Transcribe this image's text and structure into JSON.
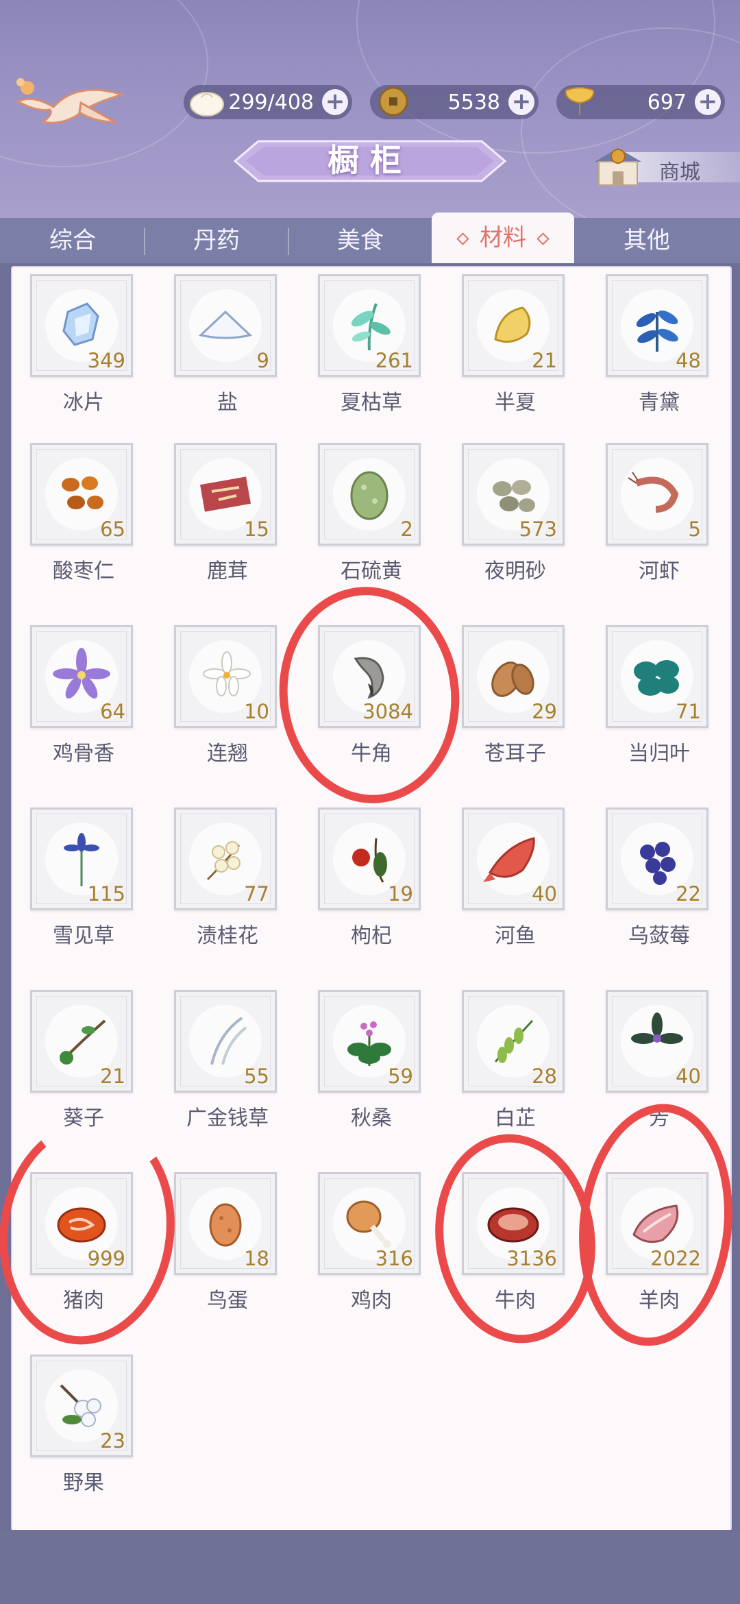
{
  "resources": [
    {
      "icon": "bun-icon",
      "value": "299/408"
    },
    {
      "icon": "coin-icon",
      "value": "5538"
    },
    {
      "icon": "ginkgo-leaf-icon",
      "value": "697"
    }
  ],
  "title": "橱柜",
  "shop_label": "商城",
  "tabs": [
    {
      "label": "综合"
    },
    {
      "label": "丹药"
    },
    {
      "label": "美食"
    },
    {
      "label": "材料",
      "active": true
    },
    {
      "label": "其他"
    }
  ],
  "items": [
    {
      "name": "冰片",
      "count": "349",
      "icon": "ice-crystal-icon"
    },
    {
      "name": "盐",
      "count": "9",
      "icon": "salt-pile-icon"
    },
    {
      "name": "夏枯草",
      "count": "261",
      "icon": "herb-icon"
    },
    {
      "name": "半夏",
      "count": "21",
      "icon": "tuber-icon"
    },
    {
      "name": "青黛",
      "count": "48",
      "icon": "blue-herb-icon"
    },
    {
      "name": "酸枣仁",
      "count": "65",
      "icon": "jujube-seed-icon"
    },
    {
      "name": "鹿茸",
      "count": "15",
      "icon": "antler-velvet-icon"
    },
    {
      "name": "石硫黄",
      "count": "2",
      "icon": "mineral-egg-icon"
    },
    {
      "name": "夜明砂",
      "count": "573",
      "icon": "pebbles-icon"
    },
    {
      "name": "河虾",
      "count": "5",
      "icon": "shrimp-icon"
    },
    {
      "name": "鸡骨香",
      "count": "64",
      "icon": "purple-flower-icon"
    },
    {
      "name": "连翘",
      "count": "10",
      "icon": "white-flower-icon"
    },
    {
      "name": "牛角",
      "count": "3084",
      "icon": "ox-horn-icon"
    },
    {
      "name": "苍耳子",
      "count": "29",
      "icon": "seed-pod-icon"
    },
    {
      "name": "当归叶",
      "count": "71",
      "icon": "green-leaf-icon"
    },
    {
      "name": "雪见草",
      "count": "115",
      "icon": "blue-flower-icon"
    },
    {
      "name": "渍桂花",
      "count": "77",
      "icon": "osmanthus-icon"
    },
    {
      "name": "枸杞",
      "count": "19",
      "icon": "goji-berry-icon"
    },
    {
      "name": "河鱼",
      "count": "40",
      "icon": "fish-icon"
    },
    {
      "name": "乌蔹莓",
      "count": "22",
      "icon": "berries-icon"
    },
    {
      "name": "葵子",
      "count": "21",
      "icon": "seed-branch-icon"
    },
    {
      "name": "广金钱草",
      "count": "55",
      "icon": "grass-blade-icon"
    },
    {
      "name": "秋桑",
      "count": "59",
      "icon": "mulberry-plant-icon"
    },
    {
      "name": "白芷",
      "count": "28",
      "icon": "green-pod-icon"
    },
    {
      "name": "芳",
      "count": "40",
      "icon": "dark-herb-icon"
    },
    {
      "name": "猪肉",
      "count": "999",
      "icon": "pork-icon"
    },
    {
      "name": "鸟蛋",
      "count": "18",
      "icon": "bird-egg-icon"
    },
    {
      "name": "鸡肉",
      "count": "316",
      "icon": "chicken-leg-icon"
    },
    {
      "name": "牛肉",
      "count": "3136",
      "icon": "beef-steak-icon"
    },
    {
      "name": "羊肉",
      "count": "2022",
      "icon": "mutton-icon"
    },
    {
      "name": "野果",
      "count": "23",
      "icon": "wild-fruit-icon"
    }
  ],
  "colors": {
    "accent": "#e0736b",
    "count": "#a7802e",
    "annotation": "#ea4a4a",
    "panel": "#fdf9fb",
    "header": "#9b93c4"
  }
}
